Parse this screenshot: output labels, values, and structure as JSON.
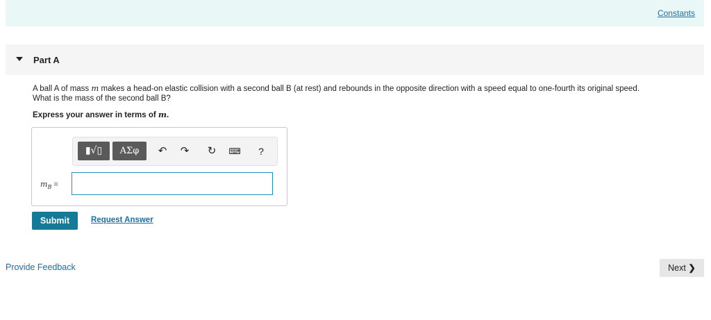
{
  "header": {
    "constants_label": "Constants"
  },
  "part": {
    "title": "Part A"
  },
  "question": {
    "text_1": "A ball A of mass ",
    "var": "m",
    "text_2": " makes a head-on elastic collision with a second ball B (at rest) and rebounds in the opposite direction with a speed equal to one-fourth its original speed.",
    "text_3": "What is the mass of the second ball B?"
  },
  "instruction": {
    "prefix": "Express your answer in terms of ",
    "var": "m",
    "suffix": "."
  },
  "toolbar": {
    "templates_label": "▮√▯",
    "greek_label": "ΑΣφ",
    "undo_glyph": "↶",
    "redo_glyph": "↷",
    "reset_glyph": "↻",
    "keyboard_glyph": "⌨",
    "help_label": "?"
  },
  "answer": {
    "var_main": "m",
    "var_sub": "B",
    "equals": " =",
    "value": ""
  },
  "actions": {
    "submit_label": "Submit",
    "request_label": "Request Answer"
  },
  "footer": {
    "feedback_label": "Provide Feedback",
    "next_label": "Next",
    "next_chevron": "❯"
  }
}
